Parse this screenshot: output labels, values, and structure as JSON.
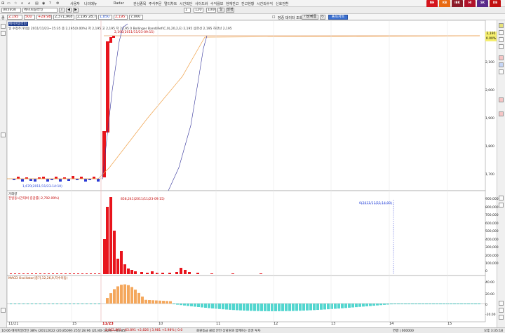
{
  "menubar": {
    "items": [
      "사용자",
      "나의메뉴",
      "Radar",
      "관심종목",
      "주식주문",
      "멀티차트",
      "시간외단",
      "사이드바",
      "수익률보",
      "현재잔고",
      "잔고현황",
      "시간외수익",
      "신호전환"
    ]
  },
  "toolbar": {
    "code": "005930",
    "name": "에이피알라인",
    "timeframe": "1",
    "count": "120",
    "interval": "1000",
    "mode": "일",
    "settings_button": "설정",
    "price": "2,195",
    "change": "500",
    "change_pct": "+29.98%",
    "volume": "2,371,908",
    "s1": "2,195 28,76",
    "s2": "1,850",
    "s3": "2,195",
    "s4": "7,000",
    "search_label": "장중 데이터 조회",
    "search_button": "가장빠름",
    "tab_active": "종목차트",
    "tab_other": "분봉"
  },
  "chart": {
    "header": "일 수정주가적용 2011/11/23~15:35 종 2,195(0.00%) 저 2,195 고 2,195 저 2,195 0 Bollinger Band(Ref(C,0),20,2,E) 2,195 상한선 2,195 하한선 2,195",
    "high_annot": "2,195(2011/11/23-09:15)",
    "low_annot": "1,670(2011/11/23-14:10)",
    "price_ticks": [
      "2,195",
      "2,100",
      "2,000",
      "1,900",
      "1,800",
      "1,700"
    ],
    "current_price": "2,195",
    "current_pct": "0.00%",
    "volume_header": "거래량",
    "volume_sub": "전일동시간대비 증감률(-2,792.09%)",
    "volume_annot": "858,241(2011/11/23-09:15)",
    "volume_cursor": "0(2011/11/23-14:00)",
    "volume_ticks": [
      "900,000",
      "800,000",
      "700,000",
      "600,000",
      "500,000",
      "400,000",
      "300,000",
      "200,000",
      "100,000",
      "0"
    ],
    "osc_header": "MACD Oscillator(종가,12,26,9,지수이동)",
    "osc_ticks": [
      "40.00",
      "20.00",
      "0",
      "-20.00"
    ],
    "x_ticks": [
      "11/21",
      "15",
      "11/23",
      "10",
      "11",
      "12",
      "13",
      "14",
      "15"
    ],
    "colors": {
      "up": "#e8141c",
      "down": "#2a3ad6",
      "ma_orange": "#f0a24a",
      "ma_blue": "#33339a",
      "osc_pos": "#f4a75c",
      "osc_neg": "#52d6cf",
      "ref_line": "#cf6a1a"
    }
  },
  "statusbar": {
    "text1": "10:06 에이피알라인 38% (20112022 (20,850원) 25일 28.96 (21/40-1829) ~83.85)",
    "text2": "2,062,891 ~63.891 +2,826 | 3,981 +5.98% | 0.0",
    "text3": "회원등급 클럽 안전 상담원과 함께하는 증권 투자",
    "text4": "연결 | 000000",
    "time": "오후 3:35:18"
  }
}
